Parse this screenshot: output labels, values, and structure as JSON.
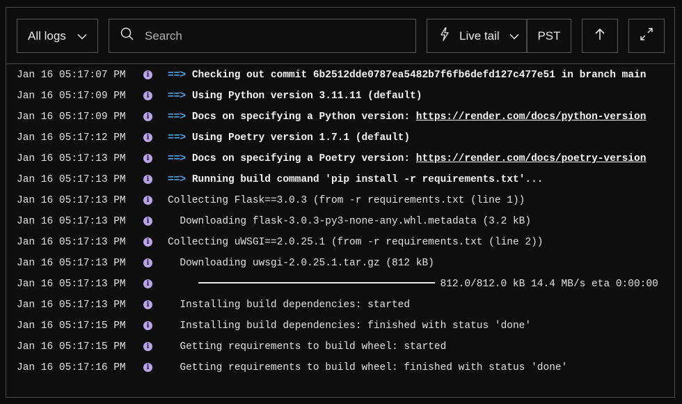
{
  "toolbar": {
    "log_filter": "All logs",
    "search_placeholder": "Search",
    "live_tail_label": "Live tail",
    "timezone": "PST"
  },
  "logs": [
    {
      "ts": "Jan 16 05:17:07 PM",
      "arrow": "==>",
      "text": "Checking out commit 6b2512dde0787ea5482b7f6fb6defd127c477e51 in branch main",
      "bold": true
    },
    {
      "ts": "Jan 16 05:17:09 PM",
      "arrow": "==>",
      "text": "Using Python version 3.11.11 (default)",
      "bold": true
    },
    {
      "ts": "Jan 16 05:17:09 PM",
      "arrow": "==>",
      "text": "Docs on specifying a Python version: ",
      "link": "https://render.com/docs/python-version",
      "bold": true
    },
    {
      "ts": "Jan 16 05:17:12 PM",
      "arrow": "==>",
      "text": "Using Poetry version 1.7.1 (default)",
      "bold": true
    },
    {
      "ts": "Jan 16 05:17:13 PM",
      "arrow": "==>",
      "text": "Docs on specifying a Poetry version: ",
      "link": "https://render.com/docs/poetry-version",
      "bold": true
    },
    {
      "ts": "Jan 16 05:17:13 PM",
      "arrow": "==>",
      "text": "Running build command 'pip install -r requirements.txt'...",
      "bold": true
    },
    {
      "ts": "Jan 16 05:17:13 PM",
      "text": "Collecting Flask==3.0.3 (from -r requirements.txt (line 1))"
    },
    {
      "ts": "Jan 16 05:17:13 PM",
      "text": "  Downloading flask-3.0.3-py3-none-any.whl.metadata (3.2 kB)"
    },
    {
      "ts": "Jan 16 05:17:13 PM",
      "text": "Collecting uWSGI==2.0.25.1 (from -r requirements.txt (line 2))"
    },
    {
      "ts": "Jan 16 05:17:13 PM",
      "text": "  Downloading uwsgi-2.0.25.1.tar.gz (812 kB)"
    },
    {
      "ts": "Jan 16 05:17:13 PM",
      "progress": 1.0,
      "text": "812.0/812.0 kB 14.4 MB/s eta 0:00:00"
    },
    {
      "ts": "Jan 16 05:17:13 PM",
      "text": "  Installing build dependencies: started"
    },
    {
      "ts": "Jan 16 05:17:15 PM",
      "text": "  Installing build dependencies: finished with status 'done'"
    },
    {
      "ts": "Jan 16 05:17:15 PM",
      "text": "  Getting requirements to build wheel: started"
    },
    {
      "ts": "Jan 16 05:17:16 PM",
      "text": "  Getting requirements to build wheel: finished with status 'done'"
    }
  ]
}
